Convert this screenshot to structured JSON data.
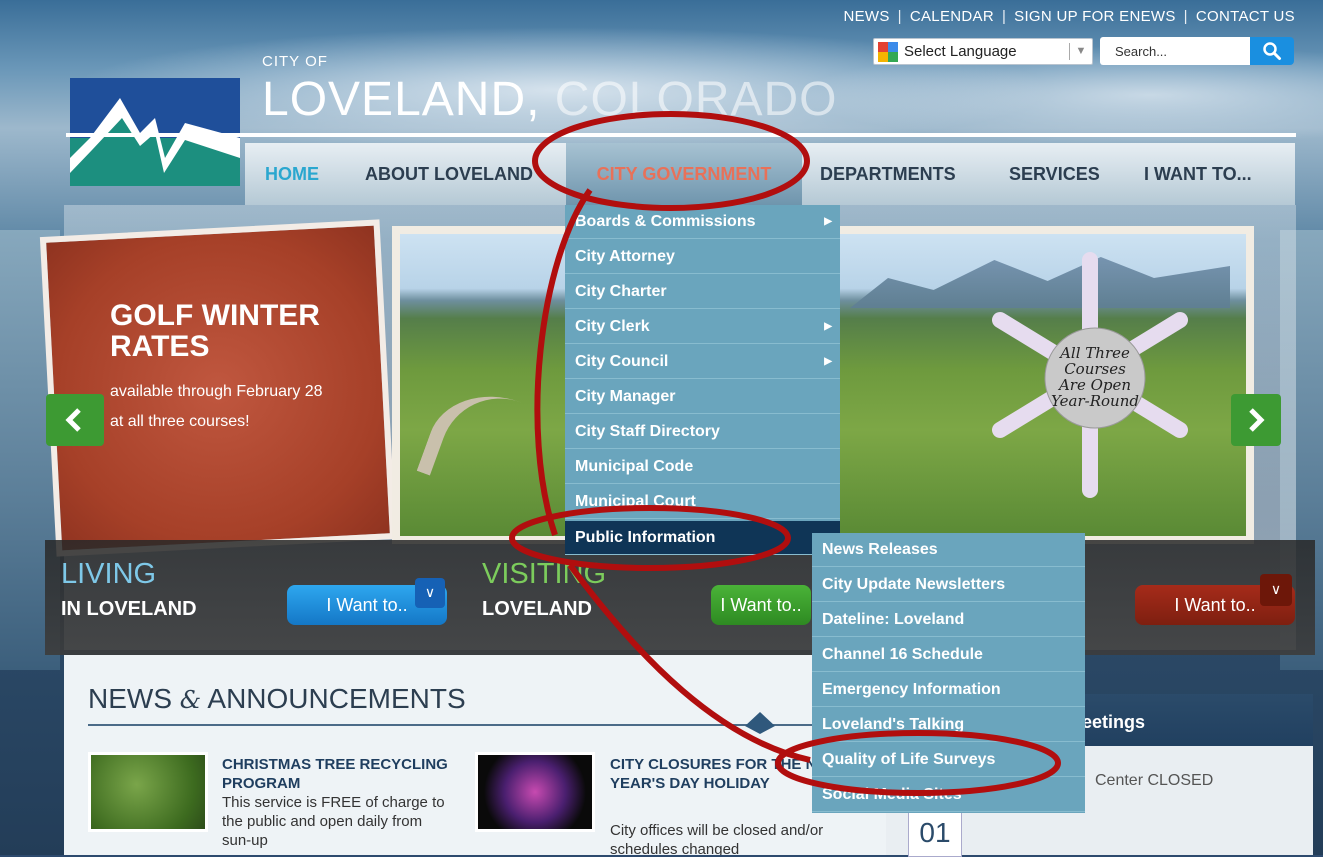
{
  "top_links": [
    "NEWS",
    "CALENDAR",
    "SIGN UP FOR ENEWS",
    "CONTACT US"
  ],
  "top_links_sep": "|",
  "language": {
    "label": "Select Language"
  },
  "search": {
    "placeholder": "Search..."
  },
  "brand": {
    "city_of": "CITY OF",
    "name": "LOVELAND,",
    "state": "COLORADO"
  },
  "nav": {
    "items": [
      "HOME",
      "ABOUT LOVELAND",
      "CITY GOVERNMENT",
      "DEPARTMENTS",
      "SERVICES",
      "I WANT TO..."
    ],
    "active": "CITY GOVERNMENT"
  },
  "slide": {
    "title_line1": "GOLF WINTER",
    "title_line2": "RATES",
    "sub_line1": "available through February 28",
    "sub_line2": "at all three courses!",
    "snowflake_lines": [
      "All Three",
      "Courses",
      "Are Open",
      "Year-Round"
    ]
  },
  "city_gov_menu": [
    {
      "label": "Boards & Commissions",
      "has_sub": true
    },
    {
      "label": "City Attorney",
      "has_sub": false
    },
    {
      "label": "City Charter",
      "has_sub": false
    },
    {
      "label": "City Clerk",
      "has_sub": true
    },
    {
      "label": "City Council",
      "has_sub": true
    },
    {
      "label": "City Manager",
      "has_sub": false
    },
    {
      "label": "City Staff Directory",
      "has_sub": false
    },
    {
      "label": "Municipal Code",
      "has_sub": false
    },
    {
      "label": "Municipal Court",
      "has_sub": false
    },
    {
      "label": "Public Information",
      "has_sub": false
    }
  ],
  "submenu_arrow": "▶",
  "public_info_menu": [
    "News Releases",
    "City Update Newsletters",
    "Dateline: Loveland",
    "Channel 16 Schedule",
    "Emergency Information",
    "Loveland's Talking",
    "Quality of Life Surveys",
    "Social Media Sites"
  ],
  "band": {
    "living": {
      "big": "LIVING",
      "small": "IN LOVELAND",
      "button": "I Want to.."
    },
    "visiting": {
      "big": "VISITING",
      "small": "LOVELAND",
      "button": "I Want to.."
    },
    "third": {
      "button": "I Want to.."
    }
  },
  "news": {
    "heading_a": "NEWS",
    "heading_amp": "&",
    "heading_b": "ANNOUNCEMENTS",
    "items": [
      {
        "title": "CHRISTMAS TREE RECYCLING PROGRAM",
        "body": "This service is FREE of charge to the public and open daily from sun-up"
      },
      {
        "title": "CITY CLOSURES FOR THE NEW YEAR'S DAY HOLIDAY",
        "body": "City offices will be closed and/or schedules changed"
      }
    ]
  },
  "meetings": {
    "title": "Meetings",
    "closed": "Center CLOSED",
    "day": "01"
  },
  "colors": {
    "nav_active": "#e87159",
    "home": "#2aa7cf",
    "annotation": "#b10e0e",
    "menu": "#6aa5bd",
    "selected": "#0f3556"
  }
}
